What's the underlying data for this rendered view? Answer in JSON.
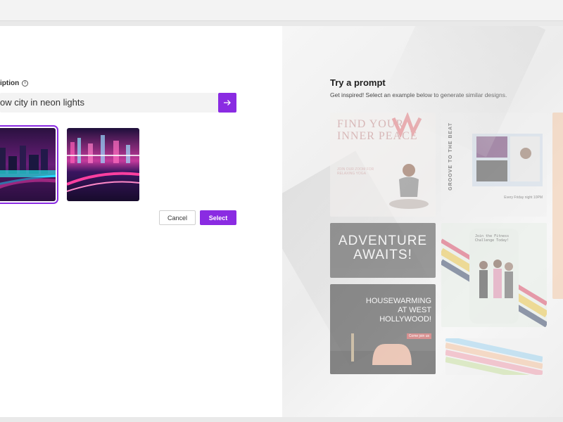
{
  "dialog": {
    "description_label": "iption",
    "prompt_value": "ow city in neon lights",
    "buttons": {
      "cancel": "Cancel",
      "select": "Select"
    }
  },
  "try_prompt": {
    "title": "Try a prompt",
    "subtitle": "Get inspired! Select an example below to generate similar designs.",
    "cards": [
      {
        "title": "FIND YOUR INNER PEACE",
        "subtext": "JOIN OUR ZOOM FOR RELAXING YOGA"
      },
      {
        "title": "GROOVE TO THE BEAT",
        "subtext": "Every Friday night 10PM"
      },
      {
        "title": "ADVENTURE AWAITS!"
      },
      {
        "title": "Join the Fitness Challenge Today!"
      },
      {
        "title": "HOUSEWARMING AT WEST HOLLYWOOD!",
        "subtext": "Come join us"
      }
    ]
  },
  "colors": {
    "accent": "#8a2be2"
  },
  "icons": {
    "arrow": "arrow-right-icon",
    "info": "info-icon"
  }
}
